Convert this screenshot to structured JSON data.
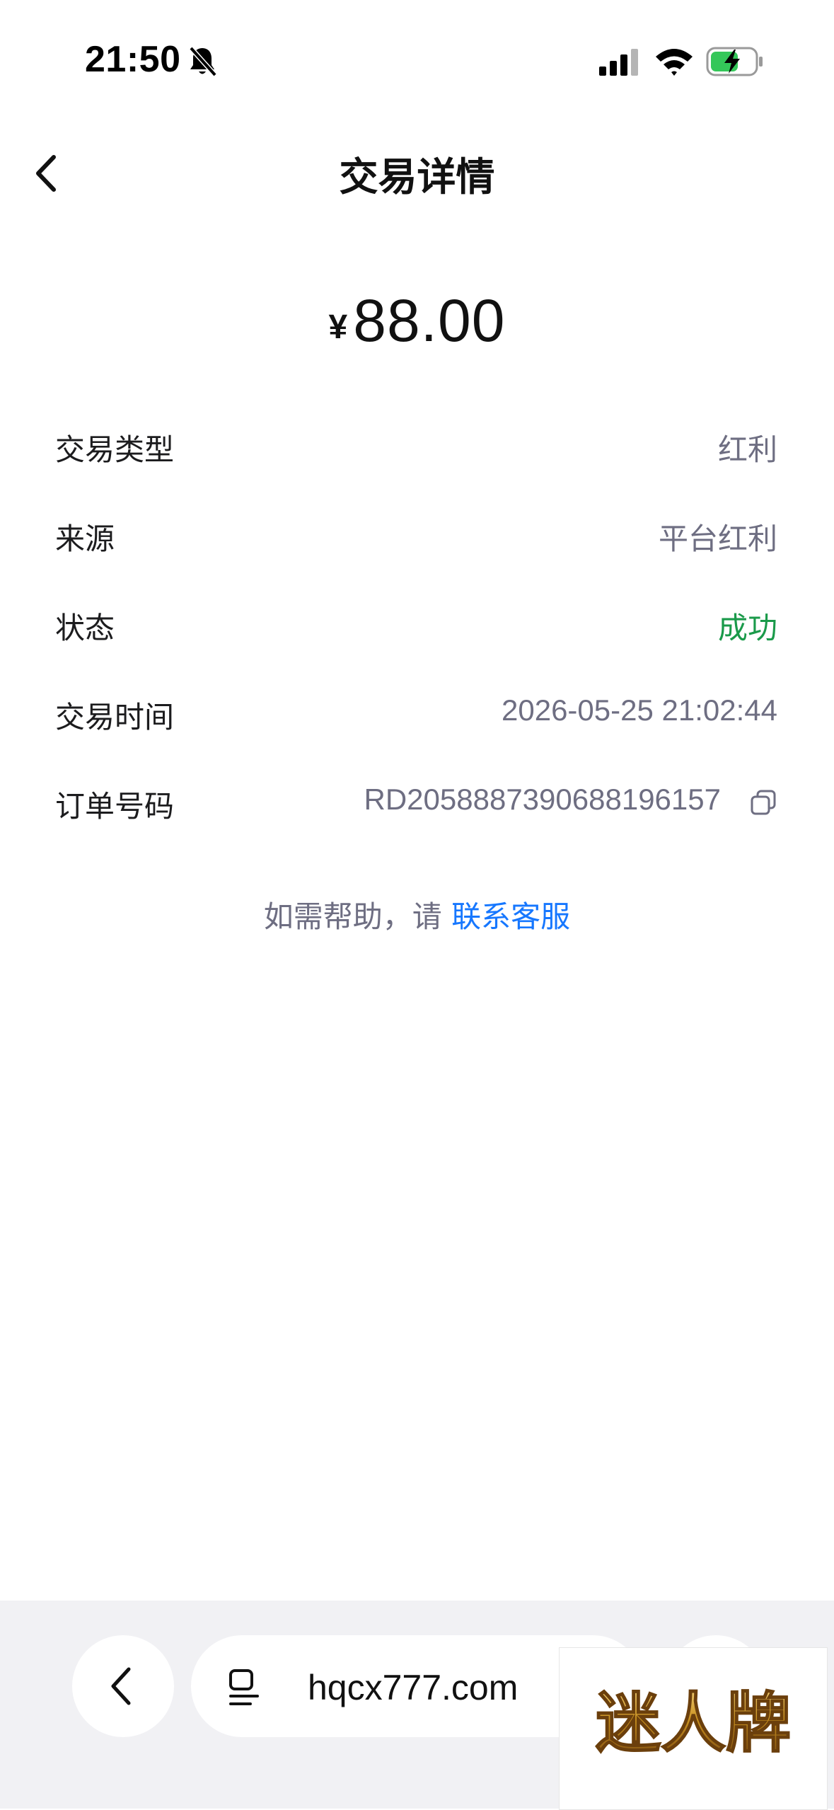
{
  "status_bar": {
    "time": "21:50",
    "icons": [
      "bell-slash-icon",
      "signal-icon",
      "wifi-icon",
      "battery-charging-icon"
    ]
  },
  "nav": {
    "title": "交易详情",
    "back_icon": "chevron-left-icon"
  },
  "amount": {
    "currency": "¥",
    "value": "88.00"
  },
  "details": [
    {
      "label": "交易类型",
      "value": "红利"
    },
    {
      "label": "来源",
      "value": "平台红利"
    },
    {
      "label": "状态",
      "value": "成功"
    },
    {
      "label": "交易时间",
      "value": "2026-05-25 21:02:44"
    },
    {
      "label": "订单号码",
      "value": "RD2058887390688196157"
    }
  ],
  "help": {
    "prefix": "如需帮助，请",
    "link": "联系客服"
  },
  "browser": {
    "url": "hqcx777.com"
  },
  "watermark": {
    "text": "迷人牌"
  },
  "colors": {
    "success": "#1a9a4a",
    "link": "#1677ff",
    "secondary_text": "#6e6e82",
    "battery": "#34c759"
  }
}
